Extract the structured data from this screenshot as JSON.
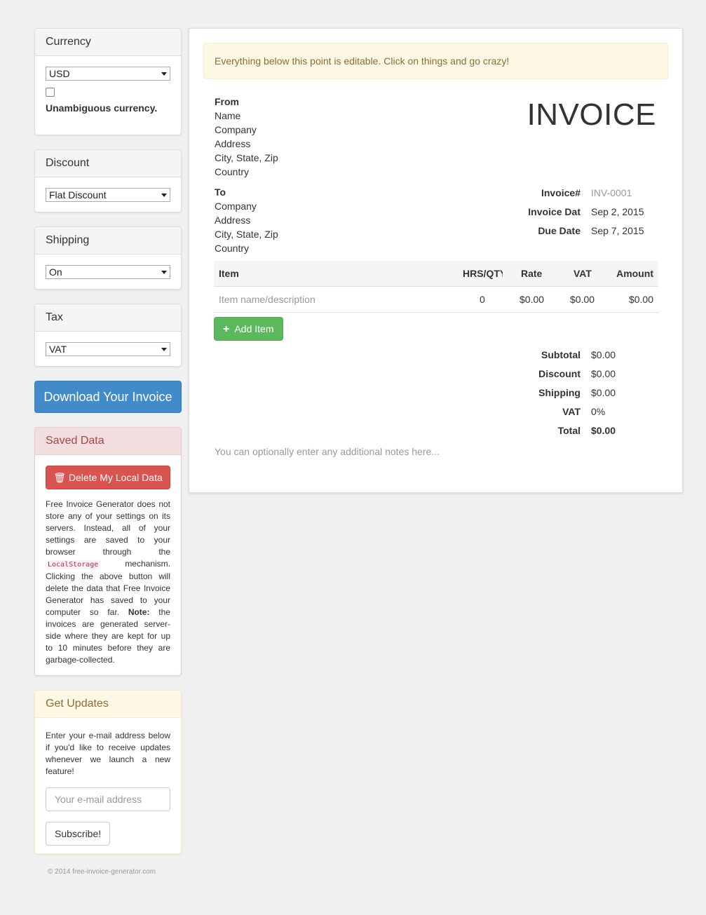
{
  "sidebar": {
    "currency": {
      "title": "Currency",
      "selected": "USD",
      "checkbox_label": "Unambiguous currency."
    },
    "discount": {
      "title": "Discount",
      "selected": "Flat Discount"
    },
    "shipping": {
      "title": "Shipping",
      "selected": "On"
    },
    "tax": {
      "title": "Tax",
      "selected": "VAT"
    },
    "download_label": "Download Your Invoice",
    "saved_data": {
      "title": "Saved Data",
      "delete_label": "Delete My Local Data",
      "text_1": "Free Invoice Generator does not store any of your settings on its servers. Instead, all of your settings are saved to your browser through the",
      "code": "LocalStorage",
      "text_2": "mechanism. Clicking the above button will delete the data that Free Invoice Generator has saved to your computer so far.",
      "note_label": "Note:",
      "text_3": "the invoices are generated server-side where they are kept for up to 10 minutes before they are garbage-collected."
    },
    "updates": {
      "title": "Get Updates",
      "text": "Enter your e-mail address below if you'd like to receive updates whenever we launch a new feature!",
      "email_placeholder": "Your e-mail address",
      "subscribe_label": "Subscribe!"
    },
    "copyright": "© 2014 free-invoice-generator.com"
  },
  "invoice": {
    "alert": "Everything below this point is editable. Click on things and go crazy!",
    "title": "INVOICE",
    "from": {
      "heading": "From",
      "lines": [
        "Name",
        "Company",
        "Address",
        "City, State, Zip",
        "Country"
      ]
    },
    "to": {
      "heading": "To",
      "lines": [
        "Company",
        "Address",
        "City, State, Zip",
        "Country"
      ]
    },
    "meta": [
      {
        "label": "Invoice#",
        "value": "INV-0001",
        "muted": true
      },
      {
        "label": "Invoice Dat",
        "value": "Sep 2, 2015",
        "muted": false
      },
      {
        "label": "Due Date",
        "value": "Sep 7, 2015",
        "muted": false
      }
    ],
    "table": {
      "headers": {
        "item": "Item",
        "qty": "HRS/QTY",
        "rate": "Rate",
        "vat": "VAT",
        "amount": "Amount"
      },
      "row": {
        "item": "Item name/description",
        "qty": "0",
        "rate": "$0.00",
        "vat": "$0.00",
        "amount": "$0.00"
      }
    },
    "add_item_label": "Add Item",
    "totals": [
      {
        "label": "Subtotal",
        "value": "$0.00"
      },
      {
        "label": "Discount",
        "value": "$0.00"
      },
      {
        "label": "Shipping",
        "value": "$0.00"
      },
      {
        "label": "VAT",
        "value": "0%"
      },
      {
        "label": "Total",
        "value": "$0.00"
      }
    ],
    "notes": "You can optionally enter any additional notes here..."
  }
}
